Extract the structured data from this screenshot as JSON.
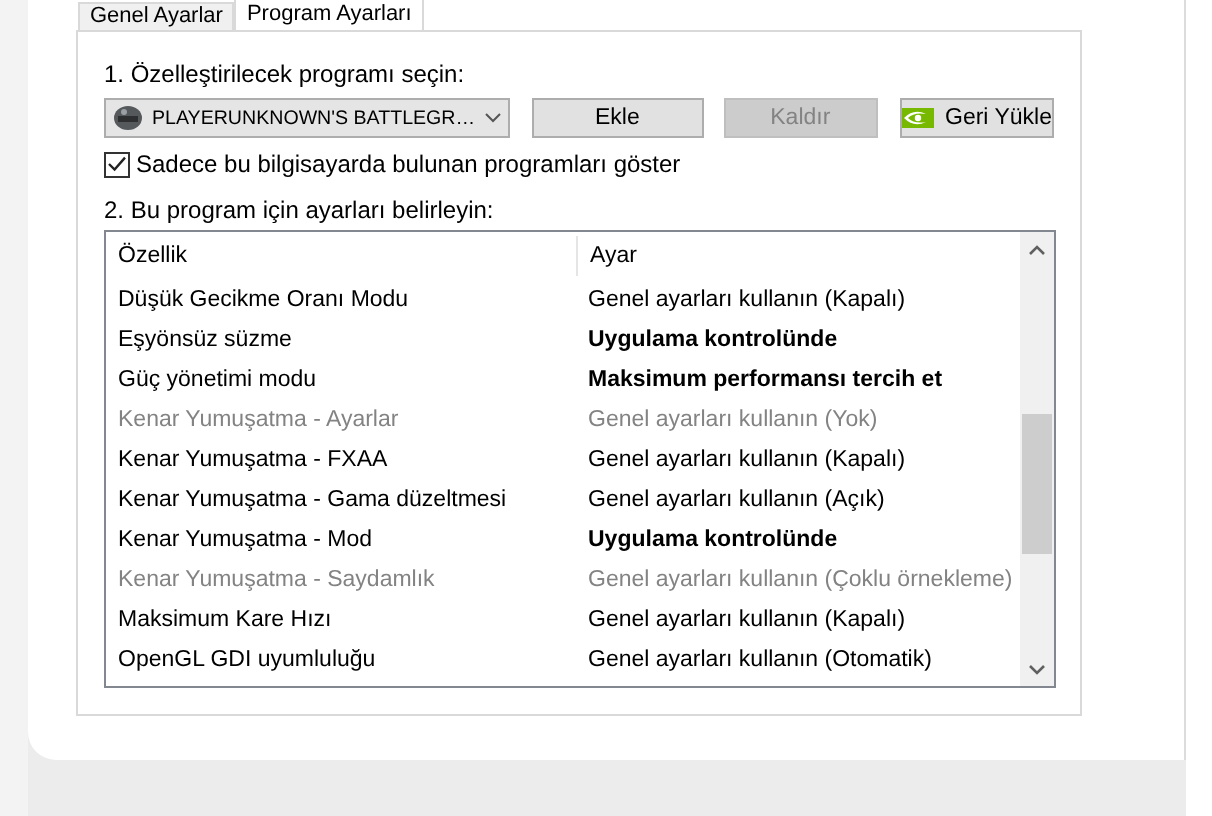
{
  "tabs": [
    {
      "label": "Genel Ayarlar",
      "selected": false
    },
    {
      "label": "Program Ayarları",
      "selected": true
    }
  ],
  "step1_label": "1. Özelleştirilecek programı seçin:",
  "program_select": {
    "value": "PLAYERUNKNOWN'S BATTLEGR…"
  },
  "buttons": [
    {
      "label": "Ekle",
      "disabled": false,
      "kind": "plain"
    },
    {
      "label": "Kaldır",
      "disabled": true,
      "kind": "plain"
    },
    {
      "label": "Geri Yükle",
      "disabled": false,
      "kind": "logo"
    }
  ],
  "only_installed": {
    "label": "Sadece bu bilgisayarda bulunan programları göster",
    "checked": true
  },
  "step2_label": "2. Bu program için ayarları belirleyin:",
  "table": {
    "columns": [
      "Özellik",
      "Ayar"
    ],
    "rows": [
      {
        "feature": "Düşük Gecikme Oranı Modu",
        "setting": "Genel ayarları kullanın (Kapalı)",
        "disabled": false,
        "bold": false
      },
      {
        "feature": "Eşyönsüz süzme",
        "setting": "Uygulama kontrolünde",
        "disabled": false,
        "bold": true
      },
      {
        "feature": "Güç yönetimi modu",
        "setting": "Maksimum performansı tercih et",
        "disabled": false,
        "bold": true
      },
      {
        "feature": "Kenar Yumuşatma - Ayarlar",
        "setting": "Genel ayarları kullanın (Yok)",
        "disabled": true,
        "bold": false
      },
      {
        "feature": "Kenar Yumuşatma - FXAA",
        "setting": "Genel ayarları kullanın (Kapalı)",
        "disabled": false,
        "bold": false
      },
      {
        "feature": "Kenar Yumuşatma - Gama düzeltmesi",
        "setting": "Genel ayarları kullanın (Açık)",
        "disabled": false,
        "bold": false
      },
      {
        "feature": "Kenar Yumuşatma - Mod",
        "setting": "Uygulama kontrolünde",
        "disabled": false,
        "bold": true
      },
      {
        "feature": "Kenar Yumuşatma - Saydamlık",
        "setting": "Genel ayarları kullanın (Çoklu örnekleme)",
        "disabled": true,
        "bold": false
      },
      {
        "feature": "Maksimum Kare Hızı",
        "setting": "Genel ayarları kullanın (Kapalı)",
        "disabled": false,
        "bold": false
      },
      {
        "feature": "OpenGL GDI uyumluluğu",
        "setting": "Genel ayarları kullanın (Otomatik)",
        "disabled": false,
        "bold": false
      }
    ]
  }
}
